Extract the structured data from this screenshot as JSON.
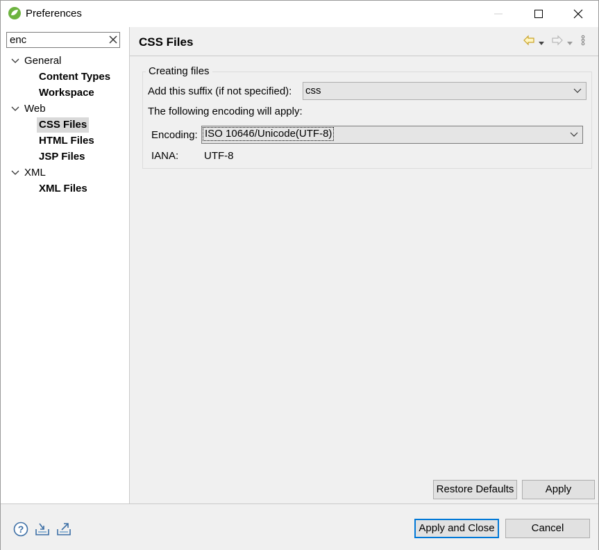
{
  "window": {
    "title": "Preferences"
  },
  "filter": {
    "value": "enc"
  },
  "tree": {
    "general": {
      "label": "General",
      "children": [
        "Content Types",
        "Workspace"
      ]
    },
    "web": {
      "label": "Web",
      "children": [
        "CSS Files",
        "HTML Files",
        "JSP Files"
      ]
    },
    "xml": {
      "label": "XML",
      "children": [
        "XML Files"
      ]
    },
    "selected": "CSS Files"
  },
  "page": {
    "title": "CSS Files",
    "group_title": "Creating files",
    "suffix_label": "Add this suffix (if not specified):",
    "suffix_value": "css",
    "encoding_intro": "The following encoding will apply:",
    "encoding_label": "Encoding:",
    "encoding_value": "ISO 10646/Unicode(UTF-8)",
    "iana_label": "IANA:",
    "iana_value": "UTF-8"
  },
  "buttons": {
    "restore_defaults": "Restore Defaults",
    "apply": "Apply",
    "apply_and_close": "Apply and Close",
    "cancel": "Cancel"
  },
  "colors": {
    "accent": "#0078d7",
    "selection": "#d9d9d9",
    "nav_back": "#c9a227"
  }
}
